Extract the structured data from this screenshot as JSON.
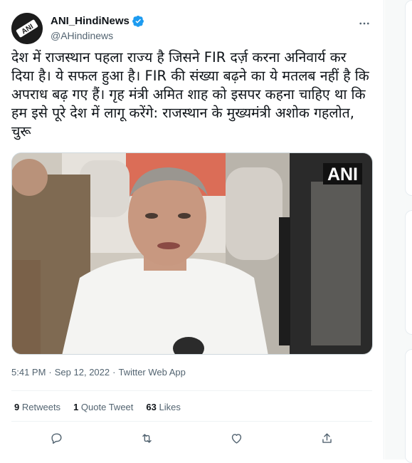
{
  "author": {
    "display_name": "ANI_HindiNews",
    "handle": "@AHindinews",
    "avatar_text": "ANI",
    "verified": true
  },
  "tweet": {
    "text": "देश में राजस्थान पहला राज्य है जिसने FIR दर्ज़ करना अनिवार्य कर दिया है। ये सफल हुआ है। FIR की संख्या बढ़ने का ये मतलब नहीं है कि अपराध बढ़ गए हैं। गृह मंत्री अमित शाह को इसपर कहना चाहिए था कि हम इसे पूरे देश में लागू करेंगे: राजस्थान के मुख्यमंत्री अशोक गहलोत, चुरू",
    "media_badge": "ANI",
    "time": "5:41 PM",
    "separator": "·",
    "date": "Sep 12, 2022",
    "source": "Twitter Web App"
  },
  "stats": {
    "retweets_count": "9",
    "retweets_label": "Retweets",
    "quotes_count": "1",
    "quotes_label": "Quote Tweet",
    "likes_count": "63",
    "likes_label": "Likes"
  },
  "colors": {
    "verified_blue": "#1d9bf0",
    "secondary_text": "#536471",
    "primary_text": "#0f1419",
    "divider": "#eff3f4"
  },
  "icons": [
    "verified-icon",
    "more-icon",
    "reply-icon",
    "retweet-icon",
    "like-icon",
    "share-icon"
  ]
}
